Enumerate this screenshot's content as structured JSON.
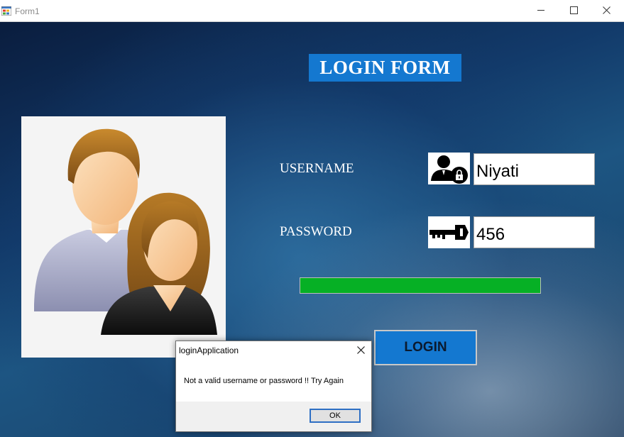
{
  "window": {
    "title": "Form1",
    "controls": [
      "minimize-icon",
      "maximize-icon",
      "close-icon"
    ]
  },
  "form": {
    "title": "LOGIN FORM",
    "avatar": "users-icon",
    "username": {
      "label": "USERNAME",
      "icon": "user-lock-icon",
      "value": "Niyati"
    },
    "password": {
      "label": "PASSWORD",
      "icon": "key-icon",
      "value": "456"
    },
    "progress": {
      "value": 1.0,
      "color": "#06b025"
    },
    "login_label": "LOGIN",
    "accent_color": "#1478d0"
  },
  "dialog": {
    "title": "loginApplication",
    "message": "Not a valid username or password !! Try Again",
    "ok_label": "OK"
  }
}
